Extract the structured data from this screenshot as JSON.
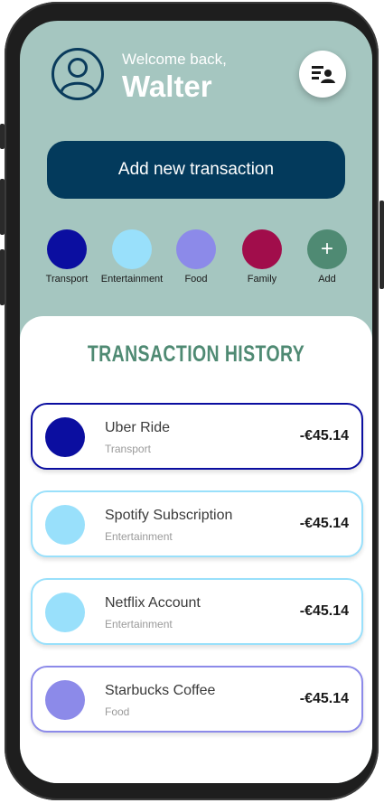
{
  "header": {
    "welcome_text": "Welcome back,",
    "user_name": "Walter"
  },
  "add_transaction_label": "Add new transaction",
  "categories": [
    {
      "label": "Transport",
      "color": "#0b0ea0"
    },
    {
      "label": "Entertainment",
      "color": "#99e0fb"
    },
    {
      "label": "Food",
      "color": "#8c8ae9"
    },
    {
      "label": "Family",
      "color": "#a10d4b"
    },
    {
      "label": "Add",
      "color": "#4f8a73",
      "icon": "plus-icon",
      "symbol": "+"
    }
  ],
  "history": {
    "title": "TRANSACTION HISTORY",
    "transactions": [
      {
        "title": "Uber Ride",
        "category": "Transport",
        "amount": "-€45.14",
        "color": "#0b0ea0"
      },
      {
        "title": "Spotify Subscription",
        "category": "Entertainment",
        "amount": "-€45.14",
        "color": "#99e0fb"
      },
      {
        "title": "Netflix Account",
        "category": "Entertainment",
        "amount": "-€45.14",
        "color": "#99e0fb"
      },
      {
        "title": "Starbucks Coffee",
        "category": "Food",
        "amount": "-€45.14",
        "color": "#8c8ae9"
      }
    ]
  },
  "colors": {
    "background": "#a5c6c0",
    "primary": "#033a5c",
    "accent_green": "#4f8a73"
  }
}
